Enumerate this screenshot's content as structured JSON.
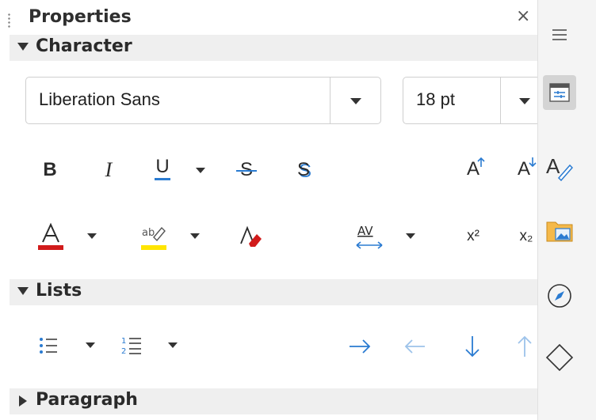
{
  "panel": {
    "title": "Properties",
    "close_glyph": "×"
  },
  "character": {
    "header": "Character",
    "font_name": "Liberation Sans",
    "font_size": "18 pt",
    "superscript_label": "x²",
    "subscript_label": "x₂",
    "bold_label": "B",
    "italic_label": "I",
    "underline_label": "U",
    "strike_label": "S",
    "shadow_label": "S",
    "grow_label": "A",
    "shrink_label": "A",
    "spacing_label": "AV",
    "colors": {
      "font_color": "#d11b1b",
      "highlight_color": "#ffe500",
      "accent": "#2a7bd1"
    }
  },
  "lists": {
    "header": "Lists"
  },
  "paragraph": {
    "header": "Paragraph"
  },
  "sidebar": {
    "items": [
      {
        "icon": "menu-icon"
      },
      {
        "icon": "properties-icon",
        "active": true
      },
      {
        "icon": "styles-icon"
      },
      {
        "icon": "gallery-icon"
      },
      {
        "icon": "navigator-icon"
      },
      {
        "icon": "shapes-icon"
      }
    ]
  }
}
